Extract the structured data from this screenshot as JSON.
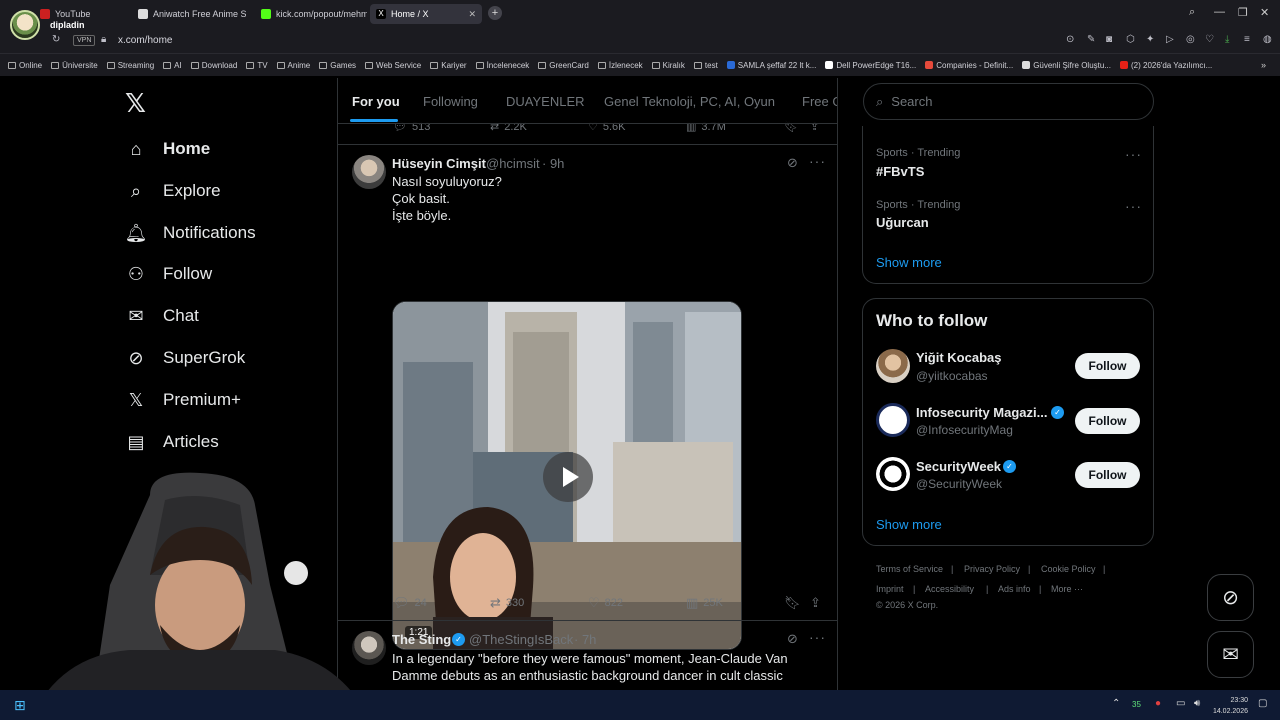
{
  "browser": {
    "profile_name": "dipladin",
    "tabs": [
      {
        "title": "YouTube",
        "color": "#cc2020",
        "active": false
      },
      {
        "title": "Aniwatch Free Anime Stre",
        "color": "#ffffff",
        "active": false
      },
      {
        "title": "kick.com/popout/mehme",
        "color": "#53fc18",
        "active": false
      },
      {
        "title": "Home / X",
        "color": "#000000",
        "active": true
      }
    ],
    "vpn_label": "VPN",
    "url": "x.com/home",
    "bookmarks": [
      {
        "label": "Online",
        "type": "folder"
      },
      {
        "label": "Üniversite",
        "type": "folder"
      },
      {
        "label": "Streaming",
        "type": "folder"
      },
      {
        "label": "AI",
        "type": "folder"
      },
      {
        "label": "Download",
        "type": "folder"
      },
      {
        "label": "TV",
        "type": "folder"
      },
      {
        "label": "Anime",
        "type": "folder"
      },
      {
        "label": "Games",
        "type": "folder"
      },
      {
        "label": "Web Service",
        "type": "folder"
      },
      {
        "label": "Kariyer",
        "type": "folder"
      },
      {
        "label": "İncelenecek",
        "type": "folder"
      },
      {
        "label": "GreenCard",
        "type": "folder"
      },
      {
        "label": "İzlenecek",
        "type": "folder"
      },
      {
        "label": "Kiralık",
        "type": "folder"
      },
      {
        "label": "test",
        "type": "folder"
      },
      {
        "label": "SAMLA şeffaf 22 lt k...",
        "type": "site",
        "color": "#2a6ad6"
      },
      {
        "label": "Dell PowerEdge T16...",
        "type": "site",
        "color": "#ffffff"
      },
      {
        "label": "Companies - Definit...",
        "type": "site",
        "color": "#e64a3b"
      },
      {
        "label": "Güvenli Şifre Oluştu...",
        "type": "site",
        "color": "#dddddd"
      },
      {
        "label": "(2) 2026'da Yazılımcı...",
        "type": "site",
        "color": "#e62117"
      }
    ]
  },
  "sidebar": {
    "logo": "𝕏",
    "items": [
      {
        "label": "Home",
        "icon": "home-icon",
        "glyph": "⌂",
        "active": true
      },
      {
        "label": "Explore",
        "icon": "search-icon",
        "glyph": "⌕",
        "active": false
      },
      {
        "label": "Notifications",
        "icon": "bell-icon",
        "glyph": "🔔︎",
        "active": false
      },
      {
        "label": "Follow",
        "icon": "add-person-icon",
        "glyph": "⚇",
        "active": false
      },
      {
        "label": "Chat",
        "icon": "mail-icon",
        "glyph": "✉",
        "active": false
      },
      {
        "label": "SuperGrok",
        "icon": "grok-icon",
        "glyph": "⊘",
        "active": false
      },
      {
        "label": "Premium+",
        "icon": "x-premium-icon",
        "glyph": "𝕏",
        "active": false
      },
      {
        "label": "Articles",
        "icon": "articles-icon",
        "glyph": "▤",
        "active": false
      }
    ]
  },
  "timeline": {
    "tabs": [
      "For you",
      "Following",
      "DUAYENLER",
      "Genel Teknoloji, PC, AI, Oyun",
      "Free G"
    ],
    "prev_tweet_actions": {
      "replies": "513",
      "reposts": "2.2K",
      "likes": "5.6K",
      "views": "3.7M"
    },
    "tweets": [
      {
        "name": "Hüseyin Cimşit",
        "handle": "@hcimsit",
        "time": "· 9h",
        "lines": [
          "Nasıl soyuluyoruz?",
          "Çok basit.",
          "İşte böyle."
        ],
        "video_duration": "1:21",
        "replies": "24",
        "reposts": "330",
        "likes": "822",
        "views": "25K"
      },
      {
        "name": "The Sting",
        "handle": "@TheStingIsBack",
        "time": "· 7h",
        "verified": true,
        "lines": [
          "In a legendary \"before they were famous\" moment, Jean-Claude Van",
          "Damme debuts as an enthusiastic background dancer in cult classic"
        ]
      }
    ]
  },
  "right": {
    "search_placeholder": "Search",
    "trends": [
      {
        "category": "Sports · Trending",
        "name": "#FBvTS"
      },
      {
        "category": "Sports · Trending",
        "name": "Uğurcan"
      }
    ],
    "trends_show_more": "Show more",
    "who_to_follow_title": "Who to follow",
    "who_to_follow": [
      {
        "name": "Yiğit Kocabaş",
        "handle": "@yiitkocabas",
        "verified": false,
        "button": "Follow"
      },
      {
        "name": "Infosecurity Magazi...",
        "handle": "@InfosecurityMag",
        "verified": true,
        "button": "Follow"
      },
      {
        "name": "SecurityWeek",
        "handle": "@SecurityWeek",
        "verified": true,
        "button": "Follow"
      }
    ],
    "wtf_show_more": "Show more",
    "footer": {
      "row1": [
        "Terms of Service",
        "|",
        "Privacy Policy",
        "|",
        "Cookie Policy",
        "|"
      ],
      "row2": [
        "Imprint",
        "|",
        "Accessibility",
        "|",
        "Ads info",
        "|",
        "More ···"
      ],
      "copyright": "© 2026 X Corp."
    }
  },
  "taskbar": {
    "time": "23:30",
    "date": "14.02.2026",
    "tray_count": "35"
  },
  "colors": {
    "accent": "#1d9bf0",
    "background": "#000000",
    "border": "#2f3336",
    "muted_text": "#71767b"
  }
}
